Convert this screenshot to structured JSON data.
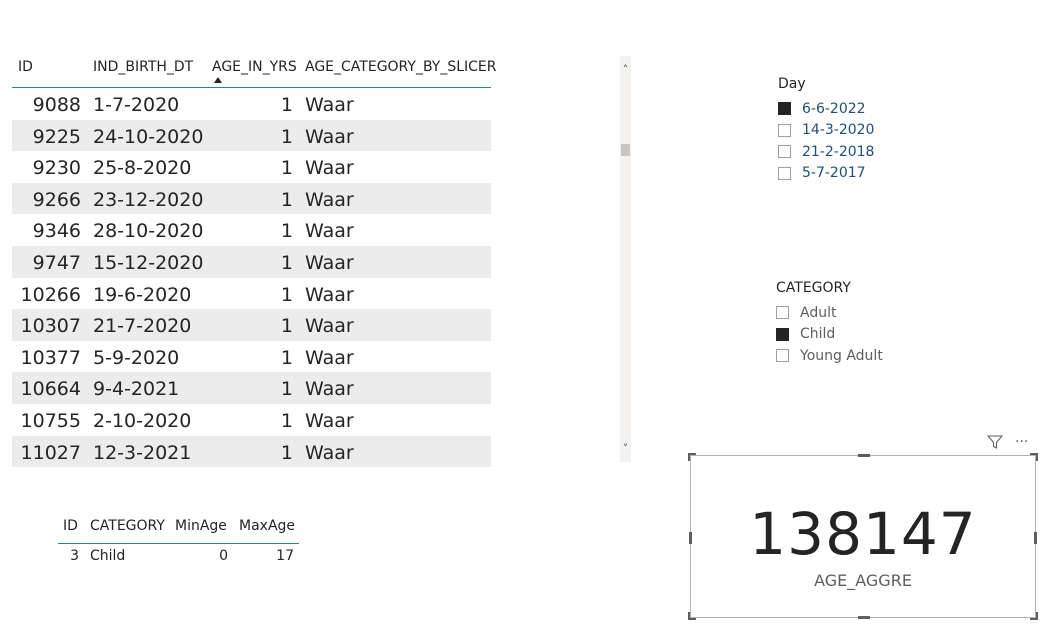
{
  "main_table": {
    "columns": [
      "ID",
      "IND_BIRTH_DT",
      "AGE_IN_YRS",
      "AGE_CATEGORY_BY_SLICER"
    ],
    "sort_indicator": "sort-ascending-icon",
    "rows": [
      [
        "9088",
        "1-7-2020",
        "1",
        "Waar"
      ],
      [
        "9225",
        "24-10-2020",
        "1",
        "Waar"
      ],
      [
        "9230",
        "25-8-2020",
        "1",
        "Waar"
      ],
      [
        "9266",
        "23-12-2020",
        "1",
        "Waar"
      ],
      [
        "9346",
        "28-10-2020",
        "1",
        "Waar"
      ],
      [
        "9747",
        "15-12-2020",
        "1",
        "Waar"
      ],
      [
        "10266",
        "19-6-2020",
        "1",
        "Waar"
      ],
      [
        "10307",
        "21-7-2020",
        "1",
        "Waar"
      ],
      [
        "10377",
        "5-9-2020",
        "1",
        "Waar"
      ],
      [
        "10664",
        "9-4-2021",
        "1",
        "Waar"
      ],
      [
        "10755",
        "2-10-2020",
        "1",
        "Waar"
      ],
      [
        "11027",
        "12-3-2021",
        "1",
        "Waar"
      ]
    ]
  },
  "scrollbar": {
    "up_icon": "chevron-up-icon",
    "down_icon": "chevron-down-icon",
    "up_glyph": "˄",
    "down_glyph": "˅"
  },
  "small_table": {
    "columns": [
      "ID",
      "CATEGORY",
      "MinAge",
      "MaxAge"
    ],
    "rows": [
      [
        "3",
        "Child",
        "0",
        "17"
      ]
    ]
  },
  "slicer_day": {
    "title": "Day",
    "items": [
      {
        "label": "6-6-2022",
        "checked": true
      },
      {
        "label": "14-3-2020",
        "checked": false
      },
      {
        "label": "21-2-2018",
        "checked": false
      },
      {
        "label": "5-7-2017",
        "checked": false
      }
    ]
  },
  "slicer_category": {
    "title": "CATEGORY",
    "items": [
      {
        "label": "Adult",
        "checked": false
      },
      {
        "label": "Child",
        "checked": true
      },
      {
        "label": "Young Adult",
        "checked": false
      }
    ]
  },
  "card": {
    "value": "138147",
    "label": "AGE_AGGRE",
    "filter_icon": "filter-icon",
    "more_icon": "more-options-icon",
    "more_glyph": "···"
  },
  "colors": {
    "header_rule": "#2b7bbb",
    "row_band": "#ececec",
    "checkbox_on": "#252423",
    "day_label": "#1f4f7a"
  }
}
